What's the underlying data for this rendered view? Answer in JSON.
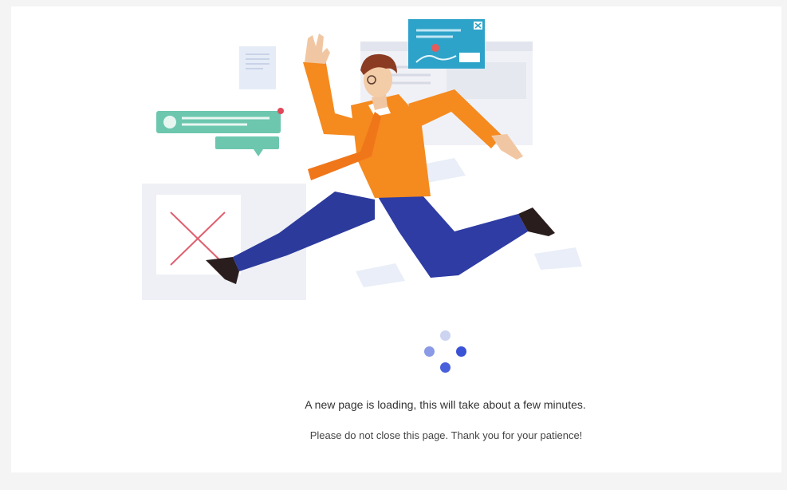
{
  "loading": {
    "message": "A new page is loading, this will take about a few minutes.",
    "note": "Please do not close this page. Thank you for your patience!"
  },
  "colors": {
    "shirt": "#f58a1f",
    "pants": "#2e3a9e",
    "teal": "#68c9b0",
    "card_blue": "#2aa0c8",
    "loader_dark": "#3a52d6",
    "loader_light": "#ccd4f2"
  },
  "icons": {
    "loader": "loading-spinner-icon",
    "illustration": "running-man-illustration"
  }
}
